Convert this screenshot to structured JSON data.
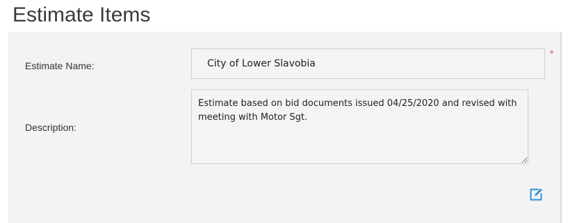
{
  "page": {
    "title": "Estimate Items"
  },
  "form": {
    "name_label": "Estimate Name:",
    "name_value": "City of Lower Slavobia",
    "required_marker": "*",
    "description_label": "Description:",
    "description_value": "Estimate based on bid documents issued 04/25/2020 and revised with meeting with Motor Sgt."
  },
  "icons": {
    "edit": "edit-icon"
  },
  "colors": {
    "panel_background": "#f3f3f3",
    "required": "#d9534f",
    "accent": "#2a8fd6"
  }
}
